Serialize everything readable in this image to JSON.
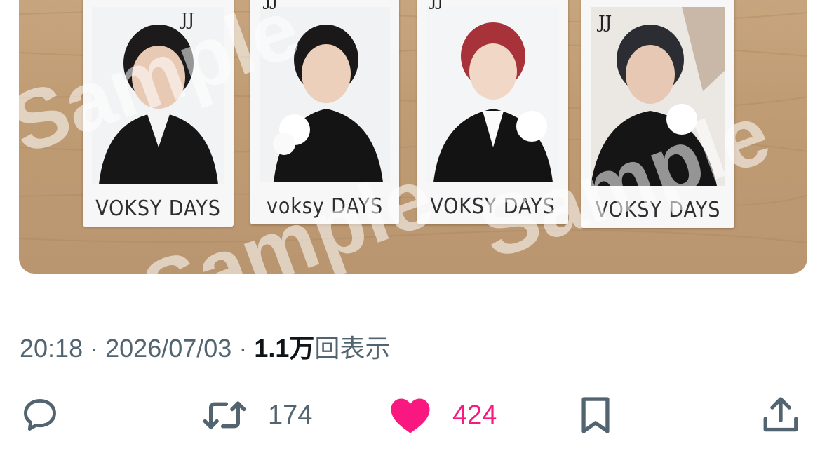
{
  "post": {
    "media": {
      "cards": [
        {
          "caption": "VOKSY DAYS",
          "tag": "JJ"
        },
        {
          "caption": "voksy DAYS",
          "tag": "JJ"
        },
        {
          "caption": "VOKSY DAYS",
          "tag": "JJ"
        },
        {
          "caption": "VOKSY DAYS",
          "tag": "JJ"
        }
      ],
      "watermark": "Sample"
    },
    "time": "20:18",
    "date": "2026/07/03",
    "separator": "·",
    "views_count": "1.1万",
    "views_label": "回表示"
  },
  "actions": {
    "reply": {
      "icon": "reply-icon"
    },
    "retweet": {
      "icon": "retweet-icon",
      "count": "174"
    },
    "like": {
      "icon": "heart-icon",
      "count": "424",
      "liked": true,
      "color": "#f91880"
    },
    "bookmark": {
      "icon": "bookmark-icon"
    },
    "share": {
      "icon": "share-icon"
    }
  },
  "colors": {
    "secondary_text": "#536471",
    "primary_text": "#0f1419",
    "like": "#f91880"
  }
}
